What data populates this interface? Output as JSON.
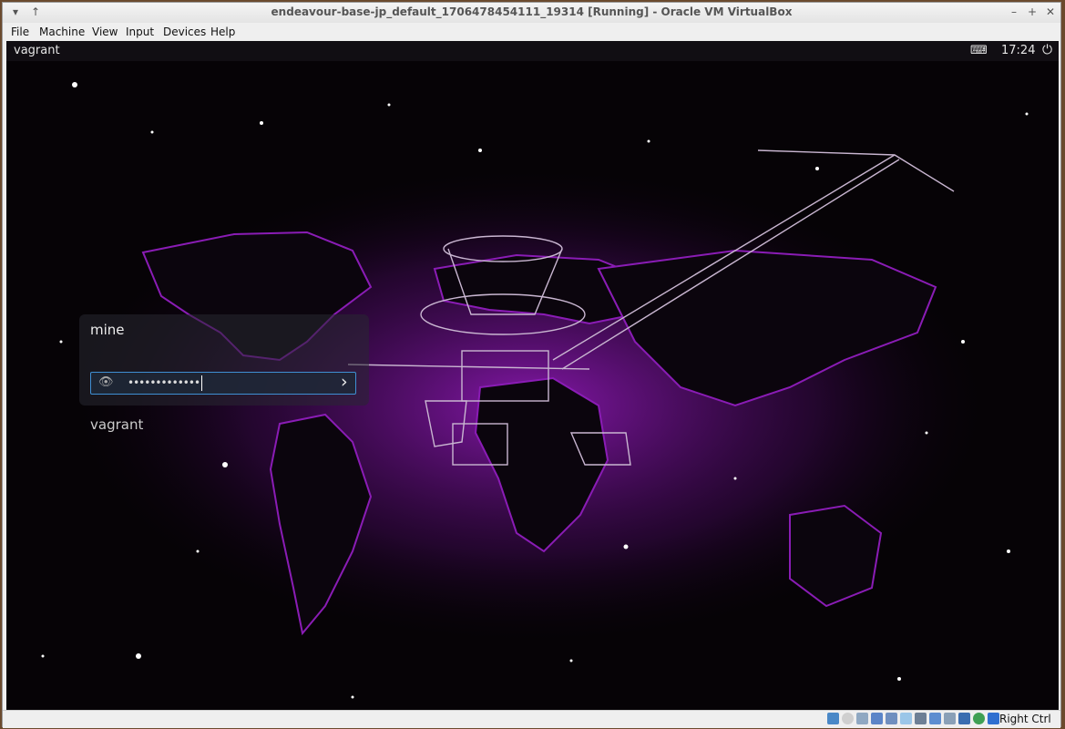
{
  "window": {
    "title": "endeavour-base-jp_default_1706478454111_19314 [Running] - Oracle VM VirtualBox",
    "controls": [
      "minimize",
      "maximize",
      "close"
    ]
  },
  "menubar": {
    "items": [
      "File",
      "Machine",
      "View",
      "Input",
      "Devices",
      "Help"
    ]
  },
  "topbar": {
    "hostname": "vagrant",
    "time": "17:24"
  },
  "login": {
    "session_label": "mine",
    "password_mask": "•••••••••••••",
    "user_label": "vagrant"
  },
  "statusbar": {
    "host_key": "Right Ctrl"
  },
  "colors": {
    "accent": "#3f8fd3",
    "nebula": "#9b1fc4"
  }
}
